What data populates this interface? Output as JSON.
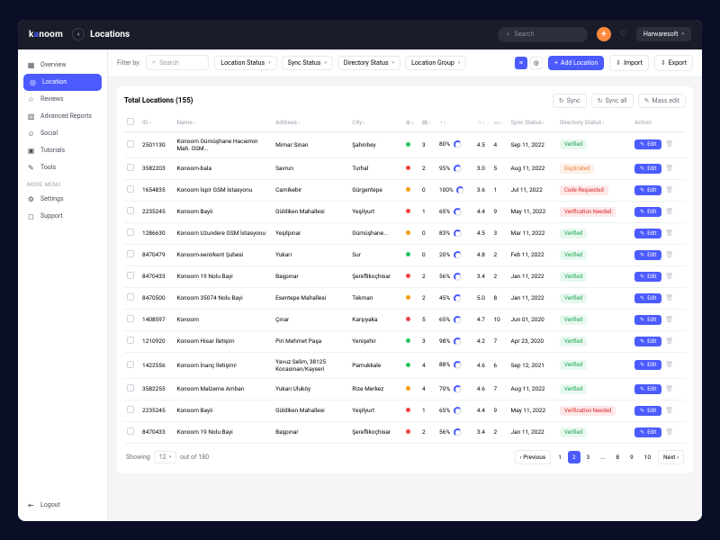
{
  "brand": {
    "pre": "k",
    "accent": "a",
    "post": "noom"
  },
  "header": {
    "page_title": "Locations",
    "search_placeholder": "Search",
    "account": "Harwaresoft"
  },
  "sidebar": {
    "items": [
      {
        "icon": "▦",
        "label": "Overview"
      },
      {
        "icon": "◎",
        "label": "Location"
      },
      {
        "icon": "☆",
        "label": "Reviews"
      },
      {
        "icon": "▥",
        "label": "Advanced Reports"
      },
      {
        "icon": "☺",
        "label": "Social"
      },
      {
        "icon": "▣",
        "label": "Tutorials"
      },
      {
        "icon": "✎",
        "label": "Tools"
      }
    ],
    "more_label": "MORE MENU",
    "more": [
      {
        "icon": "⚙",
        "label": "Settings"
      },
      {
        "icon": "◻",
        "label": "Support"
      }
    ],
    "logout": {
      "icon": "⇤",
      "label": "Logout"
    }
  },
  "filters": {
    "label": "Filter by:",
    "search_placeholder": "Search",
    "drops": [
      "Location Status",
      "Sync Status",
      "Directory Status",
      "Location Group"
    ],
    "add": "Add Location",
    "import": "Import",
    "export": "Export"
  },
  "card": {
    "title": "Total Locations (155)",
    "sync": "Sync",
    "sync_all": "Sync all",
    "mass_edit": "Mass edit"
  },
  "columns": {
    "id": "ID",
    "name": "Name",
    "address": "Address",
    "city": "City",
    "sync": "Sync Status",
    "dir": "Directory Status",
    "action": "Action",
    "edit": "Edit"
  },
  "rows": [
    {
      "id": "2501130",
      "name": "Konoom Gümüşhane Hacıemin Mah. GSM...",
      "address": "Mimar Sinan",
      "city": "Şahinbey",
      "d": "green",
      "c3": "3",
      "pct": "80%",
      "r": "4.5",
      "c5": "4",
      "date": "Sep 11, 2022",
      "status": "Verified",
      "sc": "verified"
    },
    {
      "id": "3582203",
      "name": "Konoom-bala",
      "address": "Savrun",
      "city": "Turhal",
      "d": "red",
      "c3": "2",
      "pct": "95%",
      "r": "3.0",
      "c5": "5",
      "date": "Aug 11, 2022",
      "status": "Duplicated",
      "sc": "dup"
    },
    {
      "id": "1654835",
      "name": "Konoom İspir GSM İstasyonu",
      "address": "Camikebir",
      "city": "Gürgentepe",
      "d": "yellow",
      "c3": "0",
      "pct": "100%",
      "r": "3.6",
      "c5": "1",
      "date": "Jul 11, 2022",
      "status": "Code Requested",
      "sc": "code"
    },
    {
      "id": "2235245",
      "name": "Konoom Bayii",
      "address": "Güldiken Mahallesi",
      "city": "Yeşilyurt",
      "d": "red",
      "c3": "1",
      "pct": "65%",
      "r": "4.4",
      "c5": "9",
      "date": "May 11, 2022",
      "status": "Verification Needed",
      "sc": "verif"
    },
    {
      "id": "1286630",
      "name": "Konoom Uzundere GSM İstasyonu",
      "address": "Yeşilpınar",
      "city": "Gümüşhane...",
      "d": "yellow",
      "c3": "0",
      "pct": "83%",
      "r": "4.5",
      "c5": "3",
      "date": "Mar 11, 2022",
      "status": "Verified",
      "sc": "verified"
    },
    {
      "id": "8470479",
      "name": "Konoom-senirkent Şubesi",
      "address": "Yukarı",
      "city": "Sur",
      "d": "green",
      "c3": "0",
      "pct": "20%",
      "r": "4.8",
      "c5": "2",
      "date": "Feb 11, 2022",
      "status": "Verified",
      "sc": "verified"
    },
    {
      "id": "8470433",
      "name": "Konoom 19 Nolu Bayi",
      "address": "Başpınar",
      "city": "Şereflikoçhisar",
      "d": "red",
      "c3": "2",
      "pct": "56%",
      "r": "3.4",
      "c5": "2",
      "date": "Jan 11, 2022",
      "status": "Verified",
      "sc": "verified"
    },
    {
      "id": "8470500",
      "name": "Konoom 35074 Nolu Bayi",
      "address": "Esentepe Mahallesi",
      "city": "Tekman",
      "d": "yellow",
      "c3": "2",
      "pct": "45%",
      "r": "5.0",
      "c5": "8",
      "date": "Jan 11, 2022",
      "status": "Verified",
      "sc": "verified"
    },
    {
      "id": "1408597",
      "name": "Konoom",
      "address": "Çınar",
      "city": "Karşıyaka",
      "d": "red",
      "c3": "5",
      "pct": "65%",
      "r": "4.7",
      "c5": "10",
      "date": "Jun 01, 2020",
      "status": "Verified",
      "sc": "verified"
    },
    {
      "id": "1210920",
      "name": "Konoom Hisar İletişim",
      "address": "Piri Mehmet Paşa",
      "city": "Yenişehir",
      "d": "green",
      "c3": "3",
      "pct": "98%",
      "r": "4.2",
      "c5": "7",
      "date": "Apr 23, 2020",
      "status": "Verified",
      "sc": "verified"
    },
    {
      "id": "1422556",
      "name": "Konoom İnanç İletişim!",
      "address": "Yavuz Selim, 38125 Kocasinan/Kayseri",
      "city": "Pamukkale",
      "d": "green",
      "c3": "4",
      "pct": "88%",
      "r": "4.6",
      "c5": "6",
      "date": "Sep 12, 2021",
      "status": "Verified",
      "sc": "verified"
    },
    {
      "id": "3582255",
      "name": "Konoom Malzeme Ambarı",
      "address": "Yukarı Uluköy",
      "city": "Rize Merkez",
      "d": "yellow",
      "c3": "4",
      "pct": "70%",
      "r": "4.6",
      "c5": "7",
      "date": "Aug 11, 2022",
      "status": "Verified",
      "sc": "verified"
    },
    {
      "id": "2235245",
      "name": "Konoom Bayii",
      "address": "Güldiken Mahallesi",
      "city": "Yeşilyurt",
      "d": "red",
      "c3": "1",
      "pct": "65%",
      "r": "4.4",
      "c5": "9",
      "date": "May 11, 2022",
      "status": "Verification Needed",
      "sc": "verif"
    },
    {
      "id": "8470433",
      "name": "Konoom 19 Nolu Bayi",
      "address": "Başpınar",
      "city": "Şereflikoçhisar",
      "d": "red",
      "c3": "2",
      "pct": "56%",
      "r": "3.4",
      "c5": "2",
      "date": "Jan 11, 2022",
      "status": "Verified",
      "sc": "verified"
    }
  ],
  "pager": {
    "showing": "Showing",
    "per": "12",
    "out": "out of 180",
    "prev": "Previous",
    "next": "Next",
    "pages": [
      "1",
      "2",
      "3",
      "...",
      "8",
      "9",
      "10"
    ],
    "active": "2"
  }
}
